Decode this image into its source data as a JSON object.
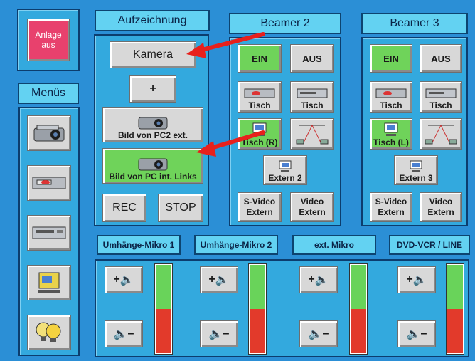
{
  "power": {
    "label": "Anlage aus"
  },
  "menus": {
    "title": "Menüs",
    "items": [
      {
        "icon": "projector-icon"
      },
      {
        "icon": "vcr-icon"
      },
      {
        "icon": "dvd-player-icon"
      },
      {
        "icon": "document-camera-icon"
      },
      {
        "icon": "light-bulbs-icon"
      }
    ]
  },
  "recording": {
    "title": "Aufzeichnung",
    "camera": "Kamera",
    "plus": "+",
    "source_pc2": "Bild von PC2 ext.",
    "source_pc": "Bild von PC int. Links",
    "rec": "REC",
    "stop": "STOP"
  },
  "beamer2": {
    "title": "Beamer 2",
    "on": "EIN",
    "off": "AUS",
    "tisch_a": "Tisch",
    "tisch_b": "Tisch",
    "tisch_r": "Tisch (R)",
    "extern": "Extern 2",
    "svideo_1": "S-Video",
    "svideo_2": "Extern",
    "video_1": "Video",
    "video_2": "Extern"
  },
  "beamer3": {
    "title": "Beamer 3",
    "on": "EIN",
    "off": "AUS",
    "tisch_a": "Tisch",
    "tisch_b": "Tisch",
    "tisch_l": "Tisch (L)",
    "extern": "Extern 3",
    "svideo_1": "S-Video",
    "svideo_2": "Extern",
    "video_1": "Video",
    "video_2": "Extern"
  },
  "audio": {
    "channels": [
      {
        "name": "Umhänge-Mikro 1",
        "up": "+",
        "down": "–",
        "level": 0.5
      },
      {
        "name": "Umhänge-Mikro 2",
        "up": "+",
        "down": "–",
        "level": 0.5
      },
      {
        "name": "ext. Mikro",
        "up": "+",
        "down": "–",
        "level": 0.5
      },
      {
        "name": "DVD-VCR / LINE",
        "up": "+",
        "down": "–",
        "level": 0.5
      }
    ]
  },
  "colors": {
    "background": "#2b8fd6",
    "panel": "#33a9de",
    "header": "#63d2f2",
    "button": "#d8d8d8",
    "active_green": "#6fd35a",
    "power_red": "#e8416d",
    "arrow_red": "#e8201c"
  }
}
